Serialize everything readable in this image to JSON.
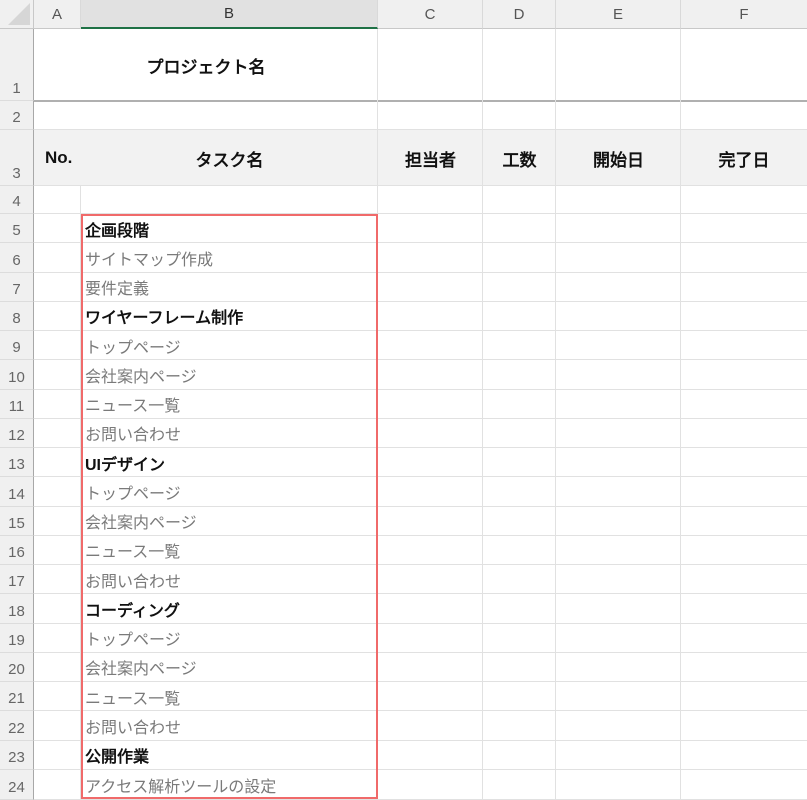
{
  "sheet": {
    "columns": [
      "A",
      "B",
      "C",
      "D",
      "E",
      "F"
    ],
    "selected_column": "B",
    "row_numbers": [
      "1",
      "2",
      "3",
      "4",
      "5",
      "6",
      "7",
      "8",
      "9",
      "10",
      "11",
      "12",
      "13",
      "14",
      "15",
      "16",
      "17",
      "18",
      "19",
      "20",
      "21",
      "22",
      "23",
      "24"
    ]
  },
  "title_cell": "プロジェクト名",
  "table_header": {
    "no": "No.",
    "task": "タスク名",
    "assignee": "担当者",
    "effort": "工数",
    "start": "開始日",
    "end": "完了日"
  },
  "tasks": [
    {
      "row": "5",
      "text": "企画段階",
      "level": "phase"
    },
    {
      "row": "6",
      "text": "サイトマップ作成",
      "level": "task"
    },
    {
      "row": "7",
      "text": "要件定義",
      "level": "task"
    },
    {
      "row": "8",
      "text": "ワイヤーフレーム制作",
      "level": "phase"
    },
    {
      "row": "9",
      "text": "トップページ",
      "level": "task"
    },
    {
      "row": "10",
      "text": "会社案内ページ",
      "level": "task"
    },
    {
      "row": "11",
      "text": "ニュース一覧",
      "level": "task"
    },
    {
      "row": "12",
      "text": "お問い合わせ",
      "level": "task"
    },
    {
      "row": "13",
      "text": "UIデザイン",
      "level": "phase"
    },
    {
      "row": "14",
      "text": "トップページ",
      "level": "task"
    },
    {
      "row": "15",
      "text": "会社案内ページ",
      "level": "task"
    },
    {
      "row": "16",
      "text": "ニュース一覧",
      "level": "task"
    },
    {
      "row": "17",
      "text": "お問い合わせ",
      "level": "task"
    },
    {
      "row": "18",
      "text": "コーディング",
      "level": "phase"
    },
    {
      "row": "19",
      "text": "トップページ",
      "level": "task"
    },
    {
      "row": "20",
      "text": "会社案内ページ",
      "level": "task"
    },
    {
      "row": "21",
      "text": "ニュース一覧",
      "level": "task"
    },
    {
      "row": "22",
      "text": "お問い合わせ",
      "level": "task"
    },
    {
      "row": "23",
      "text": "公開作業",
      "level": "phase"
    },
    {
      "row": "24",
      "text": "アクセス解析ツールの設定",
      "level": "task"
    }
  ],
  "highlight": {
    "range": "B5:B24",
    "color": "#f06a6a"
  }
}
